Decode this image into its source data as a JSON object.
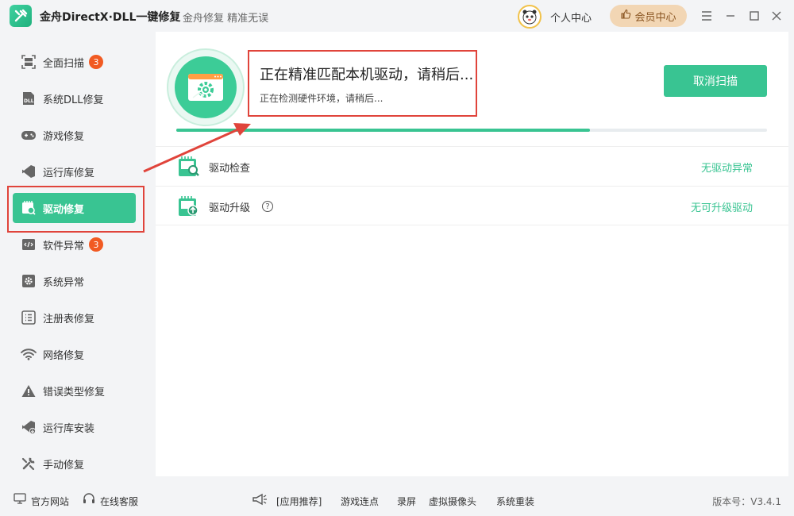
{
  "app": {
    "title": "金舟DirectX·DLL一键修复",
    "slogan": "金舟修复 精准无误"
  },
  "header": {
    "user_center": "个人中心",
    "vip_center": "会员中心"
  },
  "sidebar": {
    "items": [
      {
        "label": "全面扫描",
        "badge": "3",
        "icon": "scan-icon"
      },
      {
        "label": "系统DLL修复",
        "icon": "dll-icon"
      },
      {
        "label": "游戏修复",
        "icon": "gamepad-icon"
      },
      {
        "label": "运行库修复",
        "icon": "runtime-icon"
      },
      {
        "label": "驱动修复",
        "icon": "driver-icon",
        "active": true
      },
      {
        "label": "软件异常",
        "badge": "3",
        "icon": "code-icon"
      },
      {
        "label": "系统异常",
        "icon": "gear-icon"
      },
      {
        "label": "注册表修复",
        "icon": "list-icon"
      },
      {
        "label": "网络修复",
        "icon": "wifi-icon"
      },
      {
        "label": "错误类型修复",
        "icon": "warning-icon"
      },
      {
        "label": "运行库安装",
        "icon": "runtime-install-icon"
      },
      {
        "label": "手动修复",
        "icon": "wrench-icon"
      }
    ]
  },
  "scan": {
    "title": "正在精准匹配本机驱动，请稍后...",
    "subtitle": "正在检测硬件环境，请稍后...",
    "cancel_label": "取消扫描",
    "progress": 0.7
  },
  "results": [
    {
      "label": "驱动检查",
      "status": "无驱动异常",
      "icon": "driver-check-icon"
    },
    {
      "label": "驱动升级",
      "status": "无可升级驱动",
      "icon": "driver-upgrade-icon",
      "help": "?"
    }
  ],
  "footer": {
    "official_site": "官方网站",
    "online_service": "在线客服",
    "app_recommend": "[应用推荐]",
    "links": [
      "游戏连点",
      "录屏",
      "虚拟摄像头",
      "系统重装"
    ],
    "version": "版本号：V3.4.1"
  },
  "colors": {
    "accent": "#39c492",
    "badge": "#f15a22",
    "highlight_frame": "#e0443b",
    "vip": "#f2d6b4"
  }
}
